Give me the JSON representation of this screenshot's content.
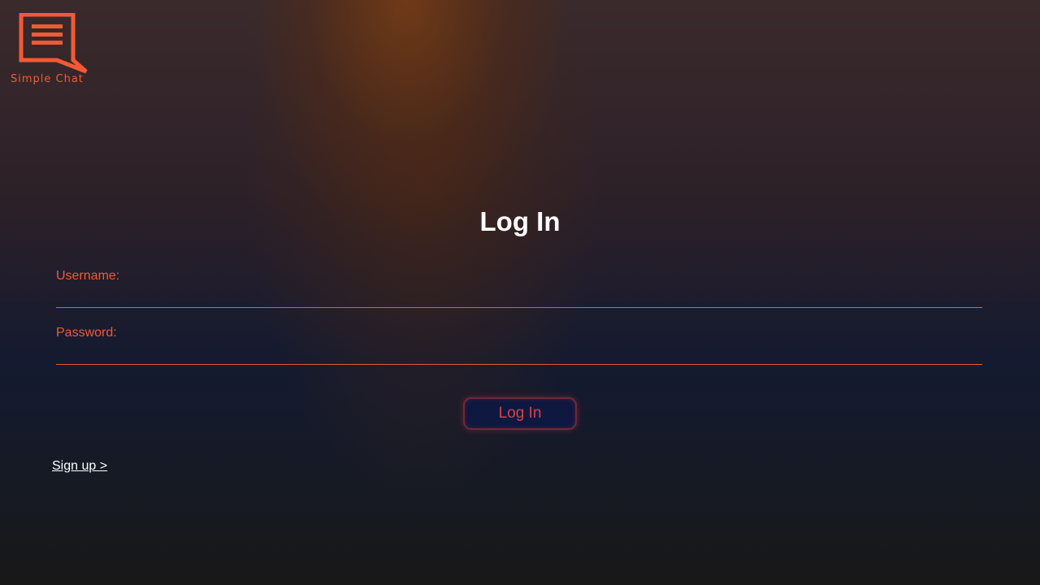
{
  "logo": {
    "text": "Simple Chat",
    "icon": "chat-bubble-icon"
  },
  "form": {
    "title": "Log In",
    "username_label": "Username:",
    "username_value": "",
    "password_label": "Password:",
    "password_value": "",
    "submit_label": "Log In"
  },
  "signup": {
    "label": "Sign up >"
  },
  "colors": {
    "accent": "#f35a33",
    "button_bg": "#0f1840",
    "button_text": "#d8404a",
    "title": "#ffffff"
  }
}
